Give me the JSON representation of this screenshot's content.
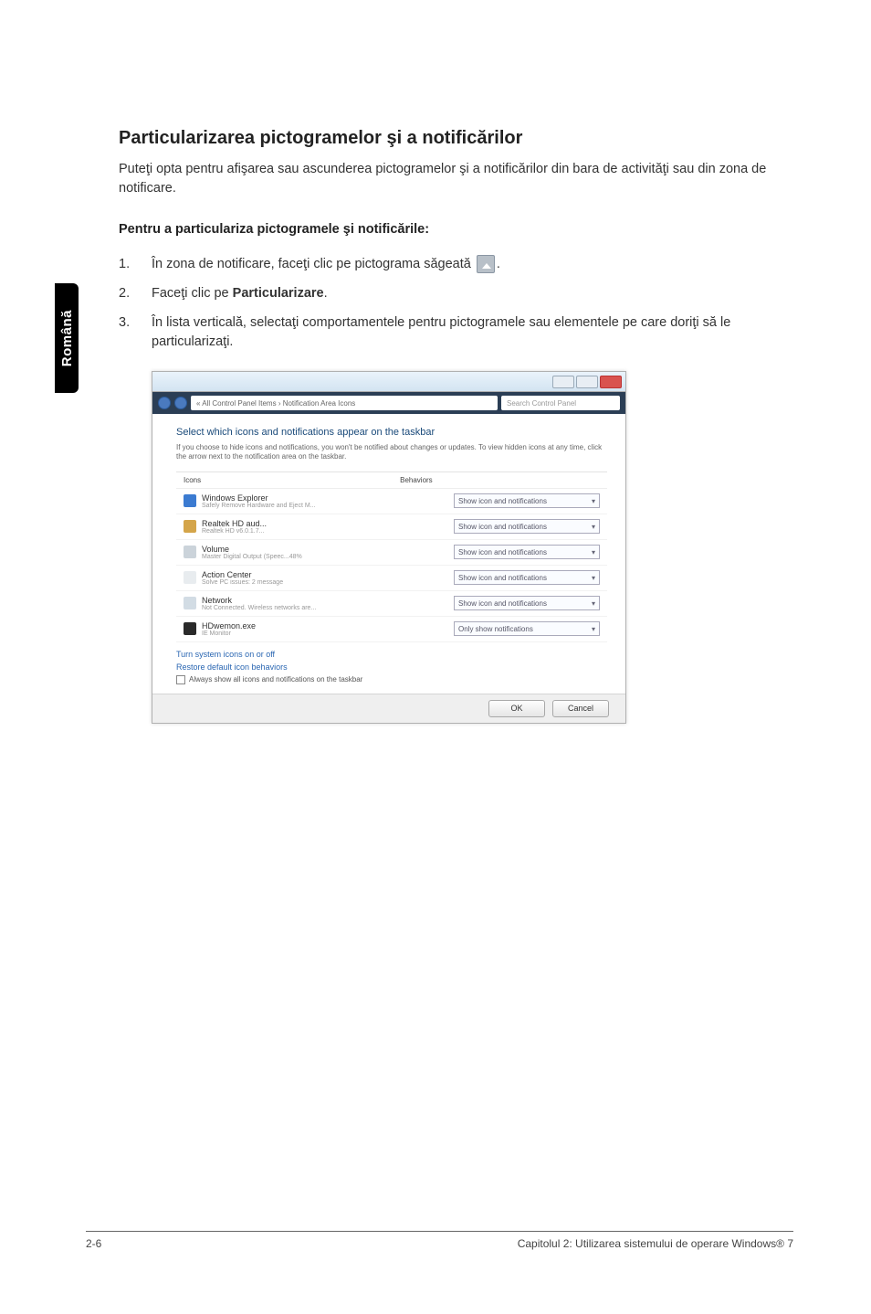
{
  "side_tab": "Română",
  "heading": "Particularizarea pictogramelor şi a notificărilor",
  "intro": "Puteţi opta pentru afişarea sau ascunderea pictogramelor şi a notificărilor din bara de activităţi sau din zona de notificare.",
  "steps_title": "Pentru a particulariza pictogramele şi notificările:",
  "steps": [
    {
      "num": "1.",
      "text_before": "În zona de notificare, faceţi clic pe pictograma săgeată ",
      "has_icon": true,
      "text_after": "."
    },
    {
      "num": "2.",
      "text_before": "Faceţi clic pe ",
      "bold": "Particularizare",
      "text_after": "."
    },
    {
      "num": "3.",
      "text_before": "În lista verticală, selectaţi comportamentele pentru pictogramele sau elementele pe care doriţi să le particularizaţi."
    }
  ],
  "screenshot": {
    "address": "« All Control Panel Items › Notification Area Icons",
    "search_placeholder": "Search Control Panel",
    "heading": "Select which icons and notifications appear on the taskbar",
    "desc": "If you choose to hide icons and notifications, you won't be notified about changes or updates. To view hidden icons at any time, click the arrow next to the notification area on the taskbar.",
    "col1": "Icons",
    "col2": "Behaviors",
    "rows": [
      {
        "title": "Windows Explorer",
        "sub": "Safely Remove Hardware and Eject M...",
        "value": "Show icon and notifications",
        "color": "#3b7bd1"
      },
      {
        "title": "Realtek HD aud...",
        "sub": "Realtek HD v6.0.1.7...",
        "value": "Show icon and notifications",
        "color": "#d4a54a"
      },
      {
        "title": "Volume",
        "sub": "Master Digital Output (Speec...48%",
        "value": "Show icon and notifications",
        "color": "#cbd3da"
      },
      {
        "title": "Action Center",
        "sub": "Solve PC issues: 2 message",
        "value": "Show icon and notifications",
        "color": "#e8ecef"
      },
      {
        "title": "Network",
        "sub": "Not Connected. Wireless networks are...",
        "value": "Show icon and notifications",
        "color": "#d2dce4"
      },
      {
        "title": "HDwemon.exe",
        "sub": "IE Monitor",
        "value": "Only show notifications",
        "color": "#2a2a2a"
      }
    ],
    "link1": "Turn system icons on or off",
    "link2": "Restore default icon behaviors",
    "checkbox_label": "Always show all icons and notifications on the taskbar",
    "ok": "OK",
    "cancel": "Cancel"
  },
  "footer": {
    "left": "2-6",
    "right": "Capitolul 2: Utilizarea sistemului de operare Windows® 7"
  }
}
